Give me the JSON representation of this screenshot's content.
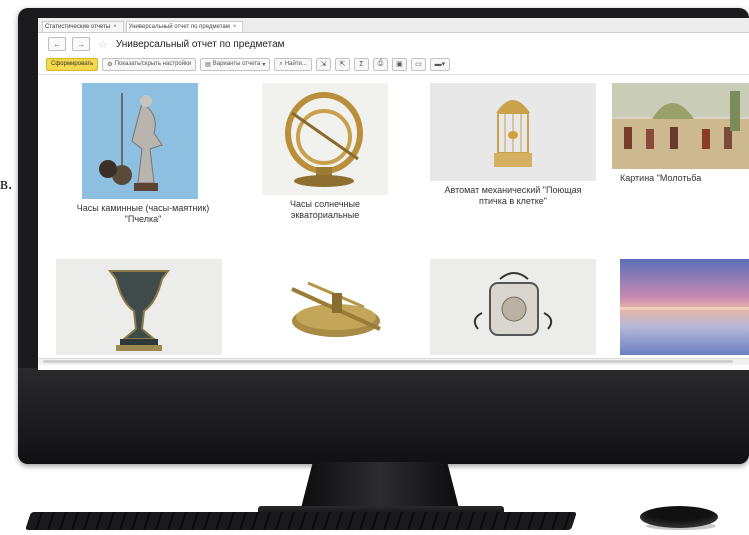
{
  "stray_text": "в.",
  "tabs": [
    {
      "label": "Статистические отчеты",
      "close": "×"
    },
    {
      "label": "Универсальный отчет по предметам",
      "close": "×"
    }
  ],
  "nav": {
    "back": "←",
    "forward": "→",
    "star": "☆",
    "title": "Универсальный отчет по предметам"
  },
  "toolbar": {
    "generate": "Сформировать",
    "show_settings": "Показать/скрыть настройки",
    "variants": "Варианты отчета",
    "find": "Найти...",
    "sigma": "Σ"
  },
  "items": [
    {
      "caption": [
        "Часы каминные (часы-маятник)",
        "\"Пчелка\""
      ]
    },
    {
      "caption": [
        "Часы солнечные",
        "экваториальные"
      ]
    },
    {
      "caption": [
        "Автомат механический \"Поющая",
        "птичка в клетке\""
      ]
    },
    {
      "caption": [
        "Картина \"Молотьба"
      ]
    },
    {
      "caption": []
    },
    {
      "caption": []
    },
    {
      "caption": []
    },
    {
      "caption": []
    }
  ],
  "colors": {
    "primary_button": "#f6d84b",
    "monitor": "#1b1b1d"
  }
}
